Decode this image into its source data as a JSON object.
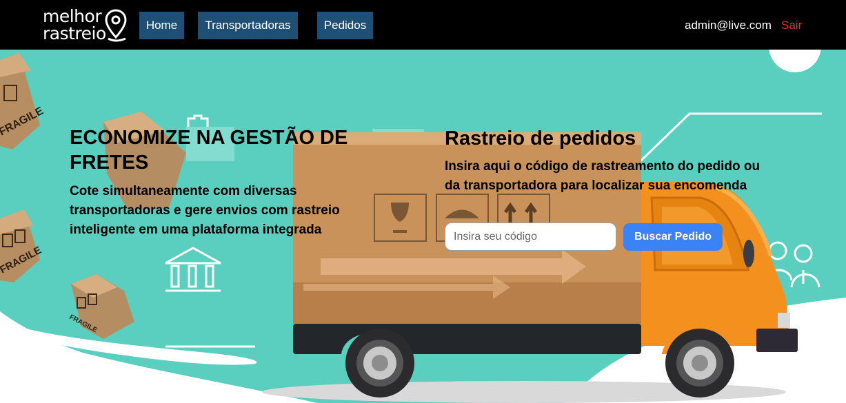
{
  "brand": {
    "line1": "melhor",
    "line2": "rastreio"
  },
  "nav": {
    "items": [
      {
        "label": "Home"
      },
      {
        "label": "Transportadoras"
      },
      {
        "label": "Pedidos"
      }
    ],
    "user_email": "admin@live.com",
    "logout_label": "Sair"
  },
  "hero": {
    "headline": "ECONOMIZE NA GESTÃO DE FRETES",
    "subheadline": "Cote simultaneamente com diversas transportadoras e gere envios com rastreio inteligente em uma plataforma integrada"
  },
  "tracking": {
    "title": "Rastreio de pedidos",
    "description": "Insira aqui o código de rastreamento do pedido ou da transportadora para localizar sua encomenda",
    "input_placeholder": "Insira seu código",
    "input_value": "",
    "button_label": "Buscar Pedido"
  },
  "illustration": {
    "box_label": "FRAGILE",
    "colors": {
      "teal_background": "#5bcfbf",
      "truck_orange": "#f4901e",
      "cargo_brown": "#c9925a",
      "nav_button": "#1f4f74",
      "search_button": "#3b82f6",
      "logout": "#e0342c"
    }
  }
}
